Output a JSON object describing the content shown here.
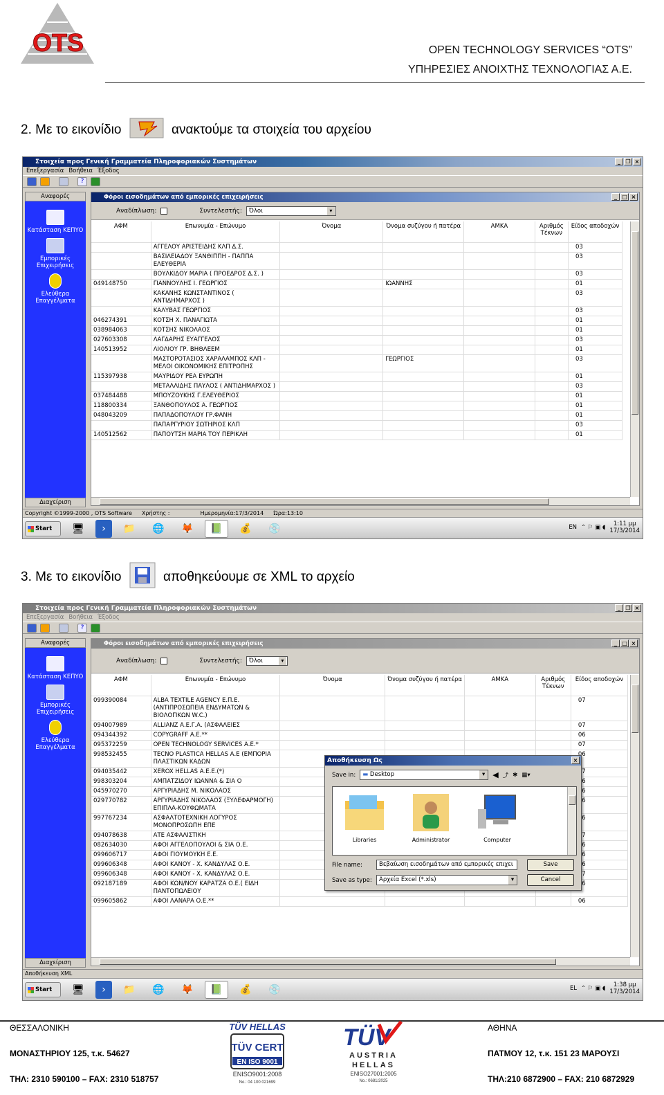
{
  "header": {
    "logo_text": "OTS",
    "company_line1": "OPEN TECHNOLOGY SERVICES “OTS”",
    "company_line2": "ΥΠΗΡΕΣΙΕΣ ΑΝΟΙΧΤΗΣ ΤΕΧΝΟΛΟΓΙΑΣ Α.Ε."
  },
  "step2": {
    "before": "2. Με το εικονίδιο",
    "after": "ανακτούμε τα στοιχεία του αρχείου"
  },
  "step3": {
    "before": "3. Με το εικονίδιο",
    "after": "αποθηκεύουμε σε XML το αρχείο"
  },
  "app": {
    "title": "Στοιχεία προς Γενική Γραμματεία Πληροφοριακών Συστημάτων",
    "menu": [
      "Επεξεργασία",
      "Βοήθεια",
      "Έξοδος"
    ],
    "sidebar_header": "Αναφορές",
    "sidebar_items": [
      "Κατάσταση ΚΕΠΥΟ",
      "Εμπορικές Επιχειρήσεις",
      "Ελεύθερα Επαγγέλματα"
    ],
    "sidebar_footer": "Διαχείριση",
    "child_title": "Φόροι εισοδημάτων από εμπορικές επιχειρήσεις",
    "filter_label": "Αναδίπλωση:",
    "contrib_label": "Συντελεστής:",
    "contrib_value": "Όλοι"
  },
  "shot1": {
    "columns": [
      "ΑΦΜ",
      "Επωνυμία - Επώνυμο",
      "Όνομα",
      "Όνομα συζύγου ή πατέρα",
      "ΑΜΚΑ",
      "Αριθμός Τέκνων",
      "Είδος αποδοχών"
    ],
    "rows": [
      [
        "",
        "ΑΓΓΕΛΟΥ ΑΡΙΣΤΕΙΔΗΣ ΚΛΠ Δ.Σ.",
        "",
        "",
        "",
        "",
        "03"
      ],
      [
        "",
        "ΒΑΣΙΛΕΙΑΔΟΥ ΞΑΝΘΙΠΠΗ - ΠΑΠΠΑ ΕΛΕΥΘΕΡΙΑ",
        "",
        "",
        "",
        "",
        "03"
      ],
      [
        "",
        "ΒΟΥΛΚΙΔΟΥ ΜΑΡΙΑ ( ΠΡΟΕΔΡΟΣ Δ.Σ. )",
        "",
        "",
        "",
        "",
        "03"
      ],
      [
        "049148750",
        "ΓΙΑΝΝΟΥΛΗΣ Ι. ΓΕΩΡΓΙΟΣ",
        "",
        "ΙΩΑΝΝΗΣ",
        "",
        "",
        "01"
      ],
      [
        "",
        "ΚΑΚΑΝΗΣ ΚΩΝΣΤΑΝΤΙΝΟΣ ( ΑΝΤΙΔΗΜΑΡΧΟΣ )",
        "",
        "",
        "",
        "",
        "03"
      ],
      [
        "",
        "ΚΑΛΥΒΑΣ ΓΕΩΡΓΙΟΣ",
        "",
        "",
        "",
        "",
        "03"
      ],
      [
        "046274391",
        "ΚΟΤΣΗ Χ. ΠΑΝΑΓΙΩΤΑ",
        "",
        "",
        "",
        "",
        "01"
      ],
      [
        "038984063",
        "ΚΟΤΣΗΣ ΝΙΚΟΛΑΟΣ",
        "",
        "",
        "",
        "",
        "01"
      ],
      [
        "027603308",
        "ΛΑΓΔΑΡΗΣ ΕΥΑΓΓΕΛΟΣ",
        "",
        "",
        "",
        "",
        "03"
      ],
      [
        "140513952",
        "ΛΙΟΛΙΟΥ ΓΡ. ΒΗΘΛΕΕΜ",
        "",
        "",
        "",
        "",
        "01"
      ],
      [
        "",
        "ΜΑΣΤΟΡΟΤΑΣΙΟΣ ΧΑΡΑΛΑΜΠΟΣ ΚΛΠ - ΜΕΛΟΙ ΟΙΚΟΝΟΜΙΚΗΣ ΕΠΙΤΡΟΠΗΣ",
        "",
        "ΓΕΩΡΓΙΟΣ",
        "",
        "",
        "03"
      ],
      [
        "115397938",
        "ΜΑΥΡΙΔΟΥ ΡΕΑ ΕΥΡΩΠΗ",
        "",
        "",
        "",
        "",
        "01"
      ],
      [
        "",
        "ΜΕΤΑΛΛΙΔΗΣ ΠΑΥΛΟΣ ( ΑΝΤΙΔΗΜΑΡΧΟΣ )",
        "",
        "",
        "",
        "",
        "03"
      ],
      [
        "037484488",
        "ΜΠΟΥΖΟΥΚΗΣ Γ.ΕΛΕΥΘΕΡΙΟΣ",
        "",
        "",
        "",
        "",
        "01"
      ],
      [
        "118800334",
        "ΞΑΝΘΟΠΟΥΛΟΣ Α. ΓΕΩΡΓΙΟΣ",
        "",
        "",
        "",
        "",
        "01"
      ],
      [
        "048043209",
        "ΠΑΠΑΔΟΠΟΥΛΟΥ ΓΡ.ΦΑΝΗ",
        "",
        "",
        "",
        "",
        "01"
      ],
      [
        "",
        "ΠΑΠΑΡΓΥΡΙΟΥ ΣΩΤΗΡΙΟΣ ΚΛΠ",
        "",
        "",
        "",
        "",
        "03"
      ],
      [
        "140512562",
        "ΠΑΠΟΥΤΣΗ ΜΑΡΙΑ ΤΟΥ ΠΕΡΙΚΛΗ",
        "",
        "",
        "",
        "",
        "01"
      ]
    ],
    "status": [
      "Copyright ©1999-2000 , OTS Software",
      "Χρήστης :",
      "Ημερομηνία:17/3/2014",
      "Ώρα:13:10"
    ],
    "lang": "EN",
    "clock_time": "1:11 μμ",
    "clock_date": "17/3/2014"
  },
  "shot2": {
    "columns": [
      "ΑΦΜ",
      "Επωνυμία - Επώνυμο",
      "Όνομα",
      "Όνομα συζύγου ή πατέρα",
      "ΑΜΚΑ",
      "Αριθμός Τέκνων",
      "Είδος αποδοχών"
    ],
    "rows": [
      [
        "099390084",
        "ALBA TEXTILE AGENCY Ε.Π.Ε. (ΑΝΤΙΠΡΟΣΩΠΕΙΑ ΕΝΔΥΜΑΤΩΝ & ΒΙΟΛΟΓΙΚΩΝ W.C.)",
        "07"
      ],
      [
        "094007989",
        "ALLIANZ Α.Ε.Γ.Α. (ΑΣΦΑΛΕΙΕΣ",
        "07"
      ],
      [
        "094344392",
        "COPYGRAFF Α.Ε.**",
        "06"
      ],
      [
        "095372259",
        "OPEN TECHNOLOGY SERVICES Α.Ε.*",
        "07"
      ],
      [
        "998532455",
        "TECNO PLASTICA HELLAS Α.Ε (ΕΜΠΟΡΙΑ ΠΛΑΣΤΙΚΩΝ ΚΑΔΩΝ",
        "06"
      ],
      [
        "094035442",
        "XEROX HELLAS Α.Ε.Ε.(*)",
        "07"
      ],
      [
        "998303204",
        "ΑΜΠΑΤΖΙΔΟΥ ΙΩΑΝΝΑ & ΣΙΑ Ο",
        "06"
      ],
      [
        "045970270",
        "ΑΡΓΥΡΙΑΔΗΣ Μ. ΝΙΚΟΛΑΟΣ",
        "06"
      ],
      [
        "029770782",
        "ΑΡΓΥΡΙΑΔΗΣ ΝΙΚΟΛΑΟΣ (ΞΥΛΕΦΑΡΜΟΓΗ) ΕΠΙΠΛΑ-ΚΟΥΦΩΜΑΤΑ",
        "06"
      ],
      [
        "997767234",
        "ΑΣΦΑΛΤΟΤΕΧΝΙΚΗ ΛΟΓΥΡΟΣ ΜΟΝΟΠΡΟΣΩΠΗ ΕΠΕ",
        "06"
      ],
      [
        "094078638",
        "ΑΤΕ ΑΣΦΑΛΙΣΤΙΚΗ",
        "07"
      ],
      [
        "082634030",
        "ΑΦΟΙ ΑΓΓΕΛΟΠΟΥΛΟΙ & ΣΙΑ Ο.Ε.",
        "06"
      ],
      [
        "099606717",
        "ΑΦΟΙ ΓΙΟΥΜΟΥΚΗ Ε.Ε.",
        "06"
      ],
      [
        "099606348",
        "ΑΦΟΙ ΚΑΝΟΥ - Χ. ΚΑΝΔΥΛΑΣ Ο.Ε.",
        "06"
      ],
      [
        "099606348",
        "ΑΦΟΙ ΚΑΝΟΥ - Χ. ΚΑΝΔΥΛΑΣ Ο.Ε.",
        "07"
      ],
      [
        "092187189",
        "ΑΦΟΙ ΚΩΝ/ΝΟΥ ΚΑΡΑΤΖΑ Ο.Ε.( ΕΙΔΗ ΠΑΝΤΟΠΩΛΕΙΟΥ",
        "06"
      ],
      [
        "099605862",
        "ΑΦΟΙ ΛΑΝΑΡΑ Ο.Ε.**",
        "06"
      ]
    ],
    "status": "Αποθήκευση XML",
    "lang": "EL",
    "clock_time": "1:38 μμ",
    "clock_date": "17/3/2014",
    "dialog": {
      "title": "Αποθήκευση Ως",
      "save_in_label": "Save in:",
      "save_in_value": "Desktop",
      "items": [
        "Libraries",
        "Administrator",
        "Computer"
      ],
      "filename_label": "File name:",
      "filename_value": "Βεβαίωση εισοδημάτων από εμπορικές επιχει",
      "type_label": "Save as type:",
      "type_value": "Αρχεία Excel (*.xls)",
      "save_button": "Save",
      "cancel_button": "Cancel"
    }
  },
  "footer": {
    "left_city": "ΘΕΣΣΑΛΟΝΙΚΗ",
    "left_addr": "ΜΟΝΑΣΤΗΡΙΟΥ 125, τ.κ. 54627",
    "left_tel": "ΤΗΛ: 2310 590100 – FAX: 2310 518757",
    "right_city": "ΑΘΗΝΑ",
    "right_addr": "ΠΑΤΜΟΥ 12, τ.κ. 151 23 ΜΑΡΟΥΣΙ",
    "right_tel": "ΤΗΛ:210 6872900 – FAX: 210 6872929",
    "cert1_top": "TÜV HELLAS",
    "cert1_mid": "TÜV CERT",
    "cert1_std": "EN ISO 9001",
    "cert1_std2": "ENISO9001:2008",
    "cert1_no": "No.: 04 100 021699",
    "cert2_logo": "TÜV",
    "cert2_l1": "AUSTRIA",
    "cert2_l2": "HELLAS",
    "cert2_std": "ENISO27001:2005",
    "cert2_no": "No.: 0681/2025"
  }
}
